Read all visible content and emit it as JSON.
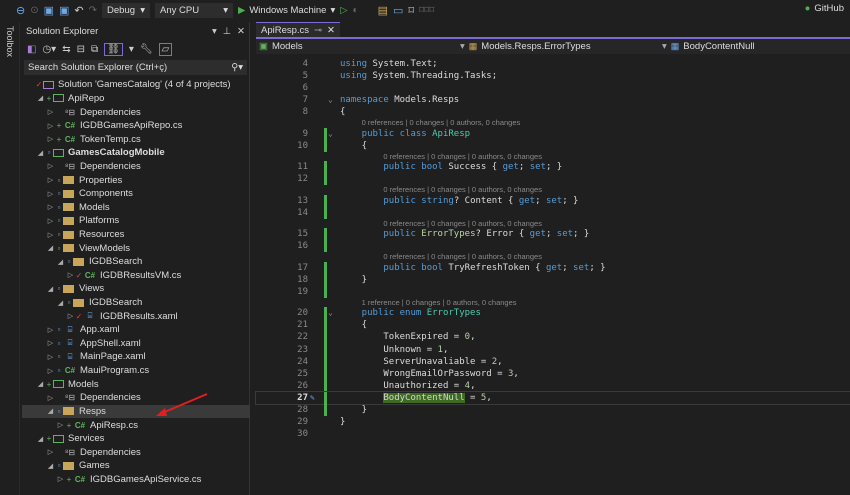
{
  "toolbar": {
    "config": "Debug",
    "platform": "Any CPU",
    "run_target": "Windows Machine",
    "github": "GitHub"
  },
  "toolbox": "Toolbox",
  "solution_explorer": {
    "title": "Solution Explorer",
    "search_placeholder": "Search Solution Explorer (Ctrl+ç)",
    "items": [
      {
        "label": "Solution 'GamesCatalog' (4 of 4 projects)",
        "depth": 0,
        "exp": "",
        "badge": "check",
        "icon": "solution"
      },
      {
        "label": "ApiRepo",
        "depth": 1,
        "exp": "open",
        "badge": "plus",
        "icon": "project"
      },
      {
        "label": "Dependencies",
        "depth": 2,
        "exp": "closed",
        "badge": "",
        "icon": "dep"
      },
      {
        "label": "IGDBGamesApiRepo.cs",
        "depth": 2,
        "exp": "closed",
        "badge": "plus",
        "icon": "cs"
      },
      {
        "label": "TokenTemp.cs",
        "depth": 2,
        "exp": "closed",
        "badge": "plus",
        "icon": "cs"
      },
      {
        "label": "GamesCatalogMobile",
        "depth": 1,
        "exp": "open",
        "badge": "lock",
        "icon": "project",
        "bold": true
      },
      {
        "label": "Dependencies",
        "depth": 2,
        "exp": "closed",
        "badge": "",
        "icon": "dep"
      },
      {
        "label": "Properties",
        "depth": 2,
        "exp": "closed",
        "badge": "lock",
        "icon": "folder"
      },
      {
        "label": "Components",
        "depth": 2,
        "exp": "closed",
        "badge": "lock",
        "icon": "folder"
      },
      {
        "label": "Models",
        "depth": 2,
        "exp": "closed",
        "badge": "lock",
        "icon": "folder"
      },
      {
        "label": "Platforms",
        "depth": 2,
        "exp": "closed",
        "badge": "lock",
        "icon": "folder"
      },
      {
        "label": "Resources",
        "depth": 2,
        "exp": "closed",
        "badge": "lock",
        "icon": "folder"
      },
      {
        "label": "ViewModels",
        "depth": 2,
        "exp": "open",
        "badge": "lock",
        "icon": "folder"
      },
      {
        "label": "IGDBSearch",
        "depth": 3,
        "exp": "open",
        "badge": "lock",
        "icon": "folder"
      },
      {
        "label": "IGDBResultsVM.cs",
        "depth": 4,
        "exp": "closed",
        "badge": "check",
        "icon": "cs"
      },
      {
        "label": "Views",
        "depth": 2,
        "exp": "open",
        "badge": "lock",
        "icon": "folder"
      },
      {
        "label": "IGDBSearch",
        "depth": 3,
        "exp": "open",
        "badge": "lock",
        "icon": "folder"
      },
      {
        "label": "IGDBResults.xaml",
        "depth": 4,
        "exp": "closed",
        "badge": "check",
        "icon": "xaml"
      },
      {
        "label": "App.xaml",
        "depth": 2,
        "exp": "closed",
        "badge": "lock",
        "icon": "xaml"
      },
      {
        "label": "AppShell.xaml",
        "depth": 2,
        "exp": "closed",
        "badge": "lock",
        "icon": "xaml"
      },
      {
        "label": "MainPage.xaml",
        "depth": 2,
        "exp": "closed",
        "badge": "lock",
        "icon": "xaml"
      },
      {
        "label": "MauiProgram.cs",
        "depth": 2,
        "exp": "closed",
        "badge": "lock",
        "icon": "cs"
      },
      {
        "label": "Models",
        "depth": 1,
        "exp": "open",
        "badge": "plus",
        "icon": "project"
      },
      {
        "label": "Dependencies",
        "depth": 2,
        "exp": "closed",
        "badge": "",
        "icon": "dep"
      },
      {
        "label": "Resps",
        "depth": 2,
        "exp": "open",
        "badge": "lock",
        "icon": "folder",
        "selected": true
      },
      {
        "label": "ApiResp.cs",
        "depth": 3,
        "exp": "closed",
        "badge": "plus",
        "icon": "cs"
      },
      {
        "label": "Services",
        "depth": 1,
        "exp": "open",
        "badge": "plus",
        "icon": "project"
      },
      {
        "label": "Dependencies",
        "depth": 2,
        "exp": "closed",
        "badge": "",
        "icon": "dep"
      },
      {
        "label": "Games",
        "depth": 2,
        "exp": "open",
        "badge": "lock",
        "icon": "folder"
      },
      {
        "label": "IGDBGamesApiService.cs",
        "depth": 3,
        "exp": "closed",
        "badge": "plus",
        "icon": "cs"
      }
    ]
  },
  "editor": {
    "tab": "ApiResp.cs",
    "nav": {
      "project": "Models",
      "type": "Models.Resps.ErrorTypes",
      "member": "BodyContentNull"
    },
    "current_line": 27,
    "lines": [
      {
        "n": 4,
        "tokens": [
          [
            "kw",
            "using "
          ],
          [
            "pl",
            "System.Text;"
          ]
        ]
      },
      {
        "n": 5,
        "tokens": [
          [
            "kw",
            "using "
          ],
          [
            "pl",
            "System.Threading.Tasks;"
          ]
        ]
      },
      {
        "n": 6,
        "tokens": []
      },
      {
        "n": 7,
        "fold": true,
        "tokens": [
          [
            "kw",
            "namespace "
          ],
          [
            "pl",
            "Models.Resps"
          ]
        ]
      },
      {
        "n": 8,
        "tokens": [
          [
            "pl",
            "{"
          ]
        ]
      },
      {
        "n": 9,
        "fold": true,
        "chg": true,
        "lens": "0 references | 0 changes | 0 authors, 0 changes",
        "indent": 4,
        "tokens": [
          [
            "kw",
            "public class "
          ],
          [
            "ty",
            "ApiResp"
          ]
        ]
      },
      {
        "n": 10,
        "chg": true,
        "indent": 4,
        "tokens": [
          [
            "pl",
            "{"
          ]
        ]
      },
      {
        "n": 11,
        "chg": true,
        "lens": "0 references | 0 changes | 0 authors, 0 changes",
        "indent": 8,
        "tokens": [
          [
            "kw",
            "public bool "
          ],
          [
            "pl",
            "Success { "
          ],
          [
            "kw",
            "get"
          ],
          [
            "pl",
            "; "
          ],
          [
            "kw",
            "set"
          ],
          [
            "pl",
            "; }"
          ]
        ]
      },
      {
        "n": 12,
        "chg": true,
        "tokens": []
      },
      {
        "n": 13,
        "chg": true,
        "lens": "0 references | 0 changes | 0 authors, 0 changes",
        "indent": 8,
        "tokens": [
          [
            "kw",
            "public string"
          ],
          [
            "pl",
            "? Content { "
          ],
          [
            "kw",
            "get"
          ],
          [
            "pl",
            "; "
          ],
          [
            "kw",
            "set"
          ],
          [
            "pl",
            "; }"
          ]
        ]
      },
      {
        "n": 14,
        "chg": true,
        "tokens": []
      },
      {
        "n": 15,
        "chg": true,
        "lens": "0 references | 0 changes | 0 authors, 0 changes",
        "indent": 8,
        "tokens": [
          [
            "kw",
            "public "
          ],
          [
            "ty2",
            "ErrorTypes"
          ],
          [
            "pl",
            "? Error { "
          ],
          [
            "kw",
            "get"
          ],
          [
            "pl",
            "; "
          ],
          [
            "kw",
            "set"
          ],
          [
            "pl",
            "; }"
          ]
        ]
      },
      {
        "n": 16,
        "chg": true,
        "tokens": []
      },
      {
        "n": 17,
        "chg": true,
        "lens": "0 references | 0 changes | 0 authors, 0 changes",
        "indent": 8,
        "tokens": [
          [
            "kw",
            "public bool "
          ],
          [
            "pl",
            "TryRefreshToken { "
          ],
          [
            "kw",
            "get"
          ],
          [
            "pl",
            "; "
          ],
          [
            "kw",
            "set"
          ],
          [
            "pl",
            "; }"
          ]
        ]
      },
      {
        "n": 18,
        "chg": true,
        "indent": 4,
        "tokens": [
          [
            "pl",
            "}"
          ]
        ]
      },
      {
        "n": 19,
        "chg": true,
        "tokens": []
      },
      {
        "n": 20,
        "fold": true,
        "chg": true,
        "lens": "1 reference | 0 changes | 0 authors, 0 changes",
        "indent": 4,
        "tokens": [
          [
            "kw",
            "public enum "
          ],
          [
            "ty",
            "ErrorTypes"
          ]
        ]
      },
      {
        "n": 21,
        "chg": true,
        "indent": 4,
        "tokens": [
          [
            "pl",
            "{"
          ]
        ]
      },
      {
        "n": 22,
        "chg": true,
        "indent": 8,
        "tokens": [
          [
            "pl",
            "TokenExpired = "
          ],
          [
            "num",
            "0"
          ],
          [
            "pl",
            ","
          ]
        ]
      },
      {
        "n": 23,
        "chg": true,
        "indent": 8,
        "tokens": [
          [
            "pl",
            "Unknown = "
          ],
          [
            "num",
            "1"
          ],
          [
            "pl",
            ","
          ]
        ]
      },
      {
        "n": 24,
        "chg": true,
        "indent": 8,
        "tokens": [
          [
            "pl",
            "ServerUnavaliable = "
          ],
          [
            "num",
            "2"
          ],
          [
            "pl",
            ","
          ]
        ]
      },
      {
        "n": 25,
        "chg": true,
        "indent": 8,
        "tokens": [
          [
            "pl",
            "WrongEmailOrPassword = "
          ],
          [
            "num",
            "3"
          ],
          [
            "pl",
            ","
          ]
        ]
      },
      {
        "n": 26,
        "chg": true,
        "indent": 8,
        "tokens": [
          [
            "pl",
            "Unauthorized = "
          ],
          [
            "num",
            "4"
          ],
          [
            "pl",
            ","
          ]
        ]
      },
      {
        "n": 27,
        "chg": true,
        "indent": 8,
        "tokens": [
          [
            "hl",
            "BodyContentNull"
          ],
          [
            "pl",
            " = "
          ],
          [
            "num",
            "5"
          ],
          [
            "pl",
            ","
          ]
        ]
      },
      {
        "n": 28,
        "chg": true,
        "indent": 4,
        "tokens": [
          [
            "pl",
            "}"
          ]
        ]
      },
      {
        "n": 29,
        "tokens": [
          [
            "pl",
            "}"
          ]
        ]
      },
      {
        "n": 30,
        "tokens": []
      }
    ]
  },
  "colors": {
    "accent": "#7b6bd6",
    "added": "#4caf50",
    "annotation_arrow": "#e02020"
  }
}
